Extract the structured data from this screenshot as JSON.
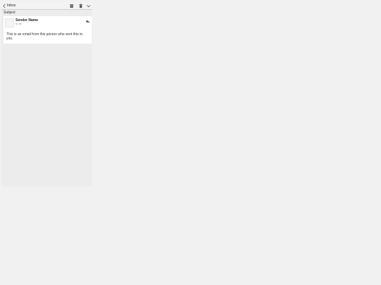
{
  "toolbar": {
    "back_label": "Inbox",
    "icons": [
      "archive-icon",
      "trash-icon",
      "chevron-down-icon"
    ]
  },
  "message": {
    "subject": "Subject",
    "sender_name": "Sender Name",
    "recipient": "to me",
    "body": "This is an email from this person who sent this to you."
  },
  "colors": {
    "background": "#f1f1f1",
    "pane": "#ececec",
    "card": "#ffffff",
    "icon": "#555555"
  }
}
